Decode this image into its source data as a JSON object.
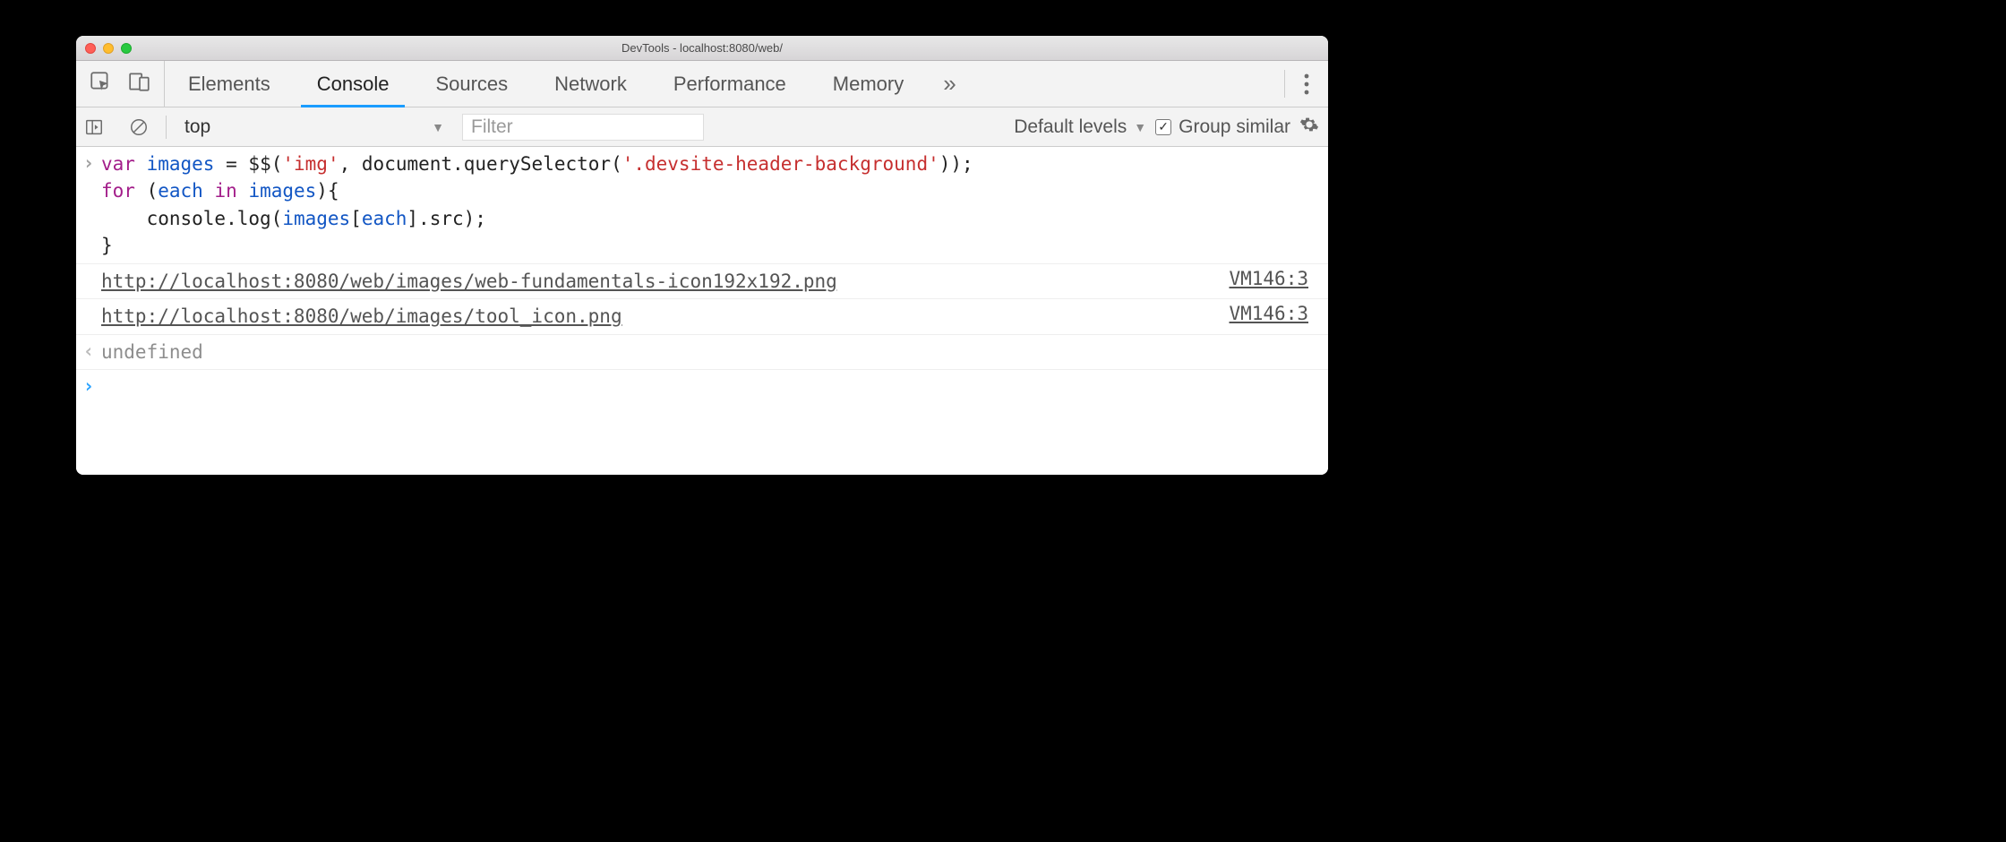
{
  "window": {
    "title": "DevTools - localhost:8080/web/"
  },
  "tabs": [
    "Elements",
    "Console",
    "Sources",
    "Network",
    "Performance",
    "Memory"
  ],
  "active_tab": "Console",
  "toolbar": {
    "context": "top",
    "filter_placeholder": "Filter",
    "levels_label": "Default levels",
    "group_similar_label": "Group similar",
    "group_similar_checked": true
  },
  "code": {
    "t0": "var",
    "t1": "images",
    "t2": "=",
    "t3": "$$",
    "t4": "(",
    "t5": "'img'",
    "t6": ",",
    "t7": "document.querySelector",
    "t8": "(",
    "t9": "'.devsite-header-background'",
    "t10": "));",
    "t11": "for",
    "t12": "(",
    "t13": "each",
    "t14": "in",
    "t15": "images",
    "t16": "){",
    "t17": "console.log",
    "t18": "(",
    "t19": "images",
    "t20": "[",
    "t21": "each",
    "t22": "].",
    "t23": "src",
    "t24": ");",
    "t25": "}"
  },
  "code_raw": "var images = $$('img', document.querySelector('.devsite-header-background'));\nfor (each in images){\n    console.log(images[each].src);\n}",
  "logs": [
    {
      "text": "http://localhost:8080/web/images/web-fundamentals-icon192x192.png",
      "source": "VM146:3"
    },
    {
      "text": "http://localhost:8080/web/images/tool_icon.png",
      "source": "VM146:3"
    }
  ],
  "return_value": "undefined"
}
